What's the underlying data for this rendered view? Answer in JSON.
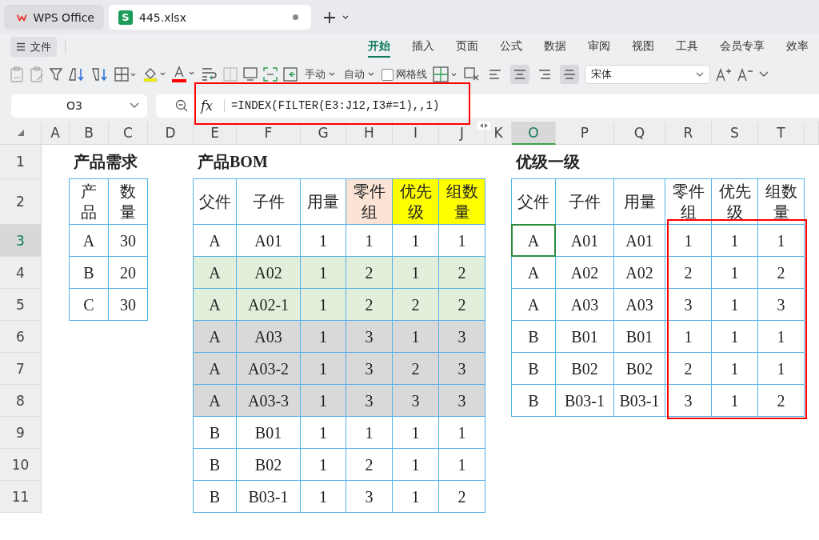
{
  "tabs": [
    {
      "kind": "home",
      "label": "WPS Office",
      "selected": false
    },
    {
      "kind": "file",
      "icon_letter": "S",
      "label": "445.xlsx",
      "selected": true,
      "modified": true
    }
  ],
  "file_menu": {
    "label": "文件"
  },
  "ribbon_tabs": [
    {
      "label": "开始",
      "selected": true
    },
    {
      "label": "插入",
      "selected": false
    },
    {
      "label": "页面",
      "selected": false
    },
    {
      "label": "公式",
      "selected": false
    },
    {
      "label": "数据",
      "selected": false
    },
    {
      "label": "审阅",
      "selected": false
    },
    {
      "label": "视图",
      "selected": false
    },
    {
      "label": "工具",
      "selected": false
    },
    {
      "label": "会员专享",
      "selected": false
    },
    {
      "label": "效率",
      "selected": false
    }
  ],
  "toolbar": {
    "dropdowns": [
      "手动",
      "自动"
    ],
    "gridlines": {
      "label": "网格线",
      "checked": false
    },
    "align_buttons": [
      {
        "on": false
      },
      {
        "on": true
      },
      {
        "on": false
      },
      {
        "on": true
      }
    ],
    "font": {
      "value": "宋体"
    }
  },
  "formula_bar": {
    "cell": "O3",
    "fx": "fx",
    "formula": "=INDEX(FILTER(E3:J12,I3#=1),,1)"
  },
  "sheet": {
    "columns": [
      {
        "label": "A",
        "selected": false
      },
      {
        "label": "B",
        "selected": false
      },
      {
        "label": "C",
        "selected": false
      },
      {
        "label": "D",
        "selected": false
      },
      {
        "label": "E",
        "selected": false
      },
      {
        "label": "F",
        "selected": false
      },
      {
        "label": "G",
        "selected": false
      },
      {
        "label": "H",
        "selected": false
      },
      {
        "label": "I",
        "selected": false
      },
      {
        "label": "J",
        "selected": false
      },
      {
        "label": "K",
        "selected": false
      },
      {
        "label": "O",
        "selected": true
      },
      {
        "label": "P",
        "selected": false
      },
      {
        "label": "Q",
        "selected": false
      },
      {
        "label": "R",
        "selected": false
      },
      {
        "label": "S",
        "selected": false
      },
      {
        "label": "T",
        "selected": false
      }
    ],
    "rows": [
      {
        "header": "1",
        "selected": false,
        "kind": "title",
        "cells": [
          "",
          "产品需求",
          "",
          "",
          "产品BOM",
          "",
          "",
          "",
          "",
          "",
          "",
          "优级一级"
        ]
      },
      {
        "header": "2",
        "selected": false,
        "kind": "data",
        "cells": [
          "",
          "产品",
          "数量",
          "",
          "父件",
          "子件",
          "用量",
          {
            "text": "零件组",
            "color": "#fbe3d5"
          },
          {
            "text": "优先级",
            "color": "#ffff00"
          },
          {
            "text": "组数量",
            "color": "#ffff00"
          },
          "",
          "父件",
          "子件",
          "用量",
          "零件组",
          "优先级",
          "组数量"
        ]
      },
      {
        "header": "3",
        "selected": true,
        "kind": "data",
        "cells": [
          "",
          "A",
          "30",
          "",
          "A",
          "A01",
          "1",
          "1",
          "1",
          "1",
          "",
          "A",
          "A01",
          "A01",
          "1",
          "1",
          "1"
        ]
      },
      {
        "header": "4",
        "selected": false,
        "kind": "data",
        "cells": [
          "",
          "B",
          "20",
          "",
          {
            "text": "A",
            "color": "#e2efda"
          },
          {
            "text": "A02",
            "color": "#e2efda"
          },
          {
            "text": "1",
            "color": "#e2efda"
          },
          {
            "text": "2",
            "color": "#e2efda"
          },
          {
            "text": "1",
            "color": "#e2efda"
          },
          {
            "text": "2",
            "color": "#e2efda"
          },
          "",
          "A",
          "A02",
          "A02",
          "2",
          "1",
          "2"
        ]
      },
      {
        "header": "5",
        "selected": false,
        "kind": "data",
        "cells": [
          "",
          "C",
          "30",
          "",
          {
            "text": "A",
            "color": "#e2efda"
          },
          {
            "text": "A02-1",
            "color": "#e2efda"
          },
          {
            "text": "1",
            "color": "#e2efda"
          },
          {
            "text": "2",
            "color": "#e2efda"
          },
          {
            "text": "2",
            "color": "#e2efda"
          },
          {
            "text": "2",
            "color": "#e2efda"
          },
          "",
          "A",
          "A03",
          "A03",
          "3",
          "1",
          "3"
        ]
      },
      {
        "header": "6",
        "selected": false,
        "kind": "data",
        "cells": [
          "",
          "",
          "",
          "",
          {
            "text": "A",
            "color": "#d9d9d9"
          },
          {
            "text": "A03",
            "color": "#d9d9d9"
          },
          {
            "text": "1",
            "color": "#d9d9d9"
          },
          {
            "text": "3",
            "color": "#d9d9d9"
          },
          {
            "text": "1",
            "color": "#d9d9d9"
          },
          {
            "text": "3",
            "color": "#d9d9d9"
          },
          "",
          "B",
          "B01",
          "B01",
          "1",
          "1",
          "1"
        ]
      },
      {
        "header": "7",
        "selected": false,
        "kind": "data",
        "cells": [
          "",
          "",
          "",
          "",
          {
            "text": "A",
            "color": "#d9d9d9"
          },
          {
            "text": "A03-2",
            "color": "#d9d9d9"
          },
          {
            "text": "1",
            "color": "#d9d9d9"
          },
          {
            "text": "3",
            "color": "#d9d9d9"
          },
          {
            "text": "2",
            "color": "#d9d9d9"
          },
          {
            "text": "3",
            "color": "#d9d9d9"
          },
          "",
          "B",
          "B02",
          "B02",
          "2",
          "1",
          "1"
        ]
      },
      {
        "header": "8",
        "selected": false,
        "kind": "data",
        "cells": [
          "",
          "",
          "",
          "",
          {
            "text": "A",
            "color": "#d9d9d9"
          },
          {
            "text": "A03-3",
            "color": "#d9d9d9"
          },
          {
            "text": "1",
            "color": "#d9d9d9"
          },
          {
            "text": "3",
            "color": "#d9d9d9"
          },
          {
            "text": "3",
            "color": "#d9d9d9"
          },
          {
            "text": "3",
            "color": "#d9d9d9"
          },
          "",
          "B",
          "B03-1",
          "B03-1",
          "3",
          "1",
          "2"
        ]
      },
      {
        "header": "9",
        "selected": false,
        "kind": "data",
        "cells": [
          "",
          "",
          "",
          "",
          "B",
          "B01",
          "1",
          "1",
          "1",
          "1"
        ]
      },
      {
        "header": "10",
        "selected": false,
        "kind": "data",
        "cells": [
          "",
          "",
          "",
          "",
          "B",
          "B02",
          "1",
          "2",
          "1",
          "1"
        ]
      },
      {
        "header": "11",
        "selected": false,
        "kind": "data",
        "cells": [
          "",
          "",
          "",
          "",
          "B",
          "B03-1",
          "1",
          "3",
          "1",
          "2"
        ]
      }
    ]
  },
  "highlights": {
    "formula_bar": true,
    "result_range": true
  }
}
